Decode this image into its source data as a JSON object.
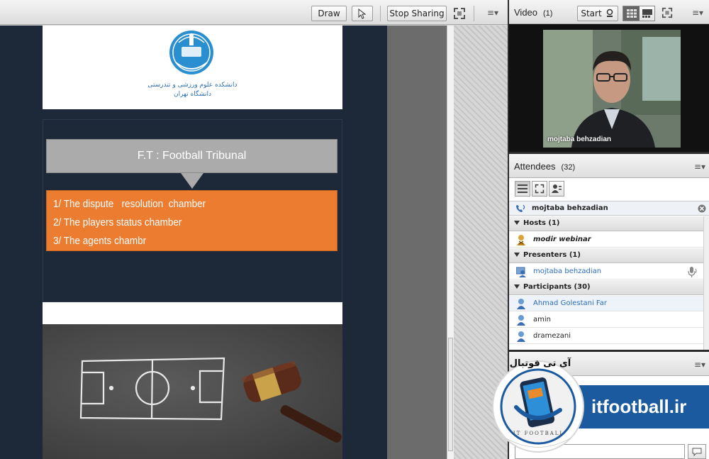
{
  "share_toolbar": {
    "draw_label": "Draw",
    "stop_sharing_label": "Stop Sharing"
  },
  "slide1": {
    "university_name_line1": "دانشکده علوم ورزشی و تندرستی",
    "university_name_line2": "دانشگاه تهران",
    "title": "F.T : Football Tribunal",
    "items": [
      "1/ The dispute   resolution  chamber",
      "2/ The players status chamber",
      "3/ The agents chambr"
    ]
  },
  "video_pod": {
    "title": "Video",
    "count": "(1)",
    "start_label": "Start",
    "presenter_name": "mojtaba behzadian"
  },
  "attendees_pod": {
    "title": "Attendees",
    "count": "(32)",
    "active_speaker": "mojtaba behzadian",
    "groups": {
      "hosts": {
        "label": "Hosts (1)",
        "members": [
          "modir webinar"
        ]
      },
      "presenters": {
        "label": "Presenters (1)",
        "members": [
          "mojtaba behzadian"
        ]
      },
      "participants": {
        "label": "Participants (30)",
        "members": [
          "Ahmad Golestani Far",
          "amin",
          "dramezani"
        ]
      }
    }
  },
  "watermark": {
    "site": "itfootball.ir",
    "persian_name": "آی تی فوتبال",
    "ring_text": "IT FOOTBALL"
  },
  "colors": {
    "slide_background": "#1d2838",
    "orange_box": "#ec7c30",
    "title_box": "#ababab",
    "link_blue": "#2a6ebd",
    "watermark_blue": "#1b5a9e"
  }
}
